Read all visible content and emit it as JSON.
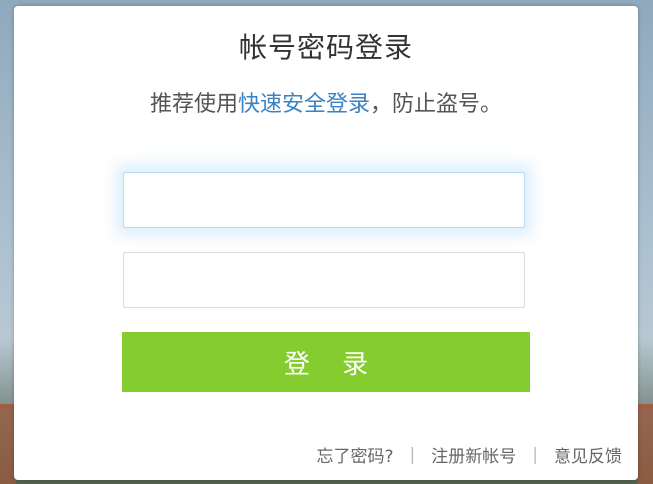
{
  "title": "帐号密码登录",
  "subtitle": {
    "before": "推荐使用",
    "link": "快速安全登录",
    "after": "，防止盗号。"
  },
  "form": {
    "account_value": "",
    "password_value": "",
    "login_label": "登 录"
  },
  "footer": {
    "forgot": "忘了密码?",
    "register": "注册新帐号",
    "feedback": "意见反馈",
    "separator": "|"
  },
  "colors": {
    "login_button": "#85cc2f",
    "link": "#3b82c4"
  }
}
